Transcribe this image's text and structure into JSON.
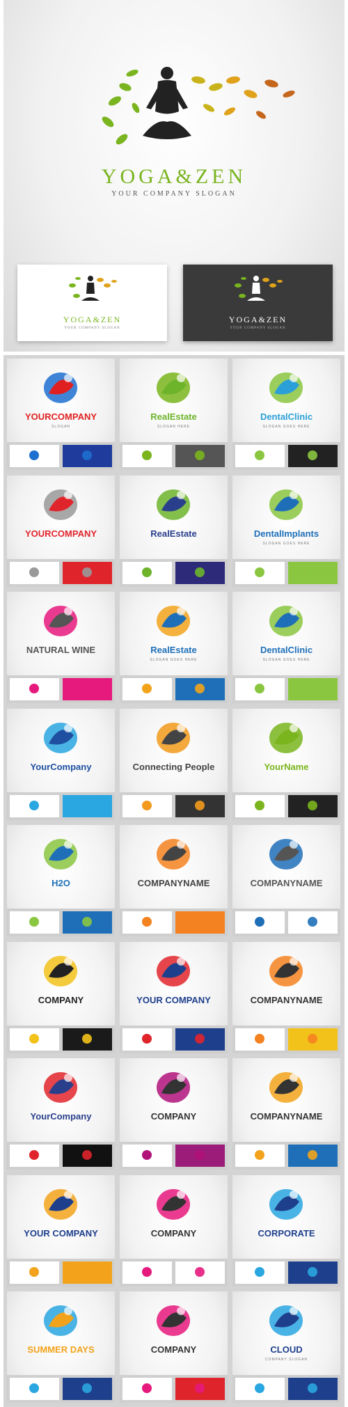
{
  "hero": {
    "title": "YOGA&ZEN",
    "slogan": "YOUR COMPANY SLOGAN",
    "title_color": "#7ab41f",
    "cards": [
      {
        "title": "YOGA&ZEN",
        "sub": "YOUR COMPANY SLOGAN",
        "variant": "light"
      },
      {
        "title": "YOGA&ZEN",
        "sub": "YOUR COMPANY SLOGAN",
        "variant": "dark"
      }
    ]
  },
  "tiles": [
    {
      "name": "YOURCOMPANY",
      "sub": "SLOGAN",
      "color": "#e02020",
      "accent": "#1d6fd0",
      "card": "#1f3c9c",
      "icon": "bird-icon"
    },
    {
      "name": "RealEstate",
      "sub": "SLOGAN HERE",
      "color": "#6db42b",
      "accent": "#7ab51d",
      "card": "#555555",
      "icon": "house-icon"
    },
    {
      "name": "DentalClinic",
      "sub": "SLOGAN GOES HERE",
      "color": "#2a9fd8",
      "accent": "#8ac640",
      "card": "#222222",
      "icon": "tooth-figure-icon"
    },
    {
      "name": "YOURCOMPANY",
      "sub": "",
      "color": "#e0242c",
      "accent": "#999999",
      "card": "#e0242c",
      "icon": "x-star-icon"
    },
    {
      "name": "RealEstate",
      "sub": "",
      "color": "#2a3f8c",
      "accent": "#6db42b",
      "card": "#2e2a7a",
      "icon": "buildings-icon"
    },
    {
      "name": "DentalImplants",
      "sub": "SLOGAN GOES HERE",
      "color": "#1e6fb8",
      "accent": "#8ac640",
      "card": "#8ac640",
      "icon": "implant-icon"
    },
    {
      "name": "NATURAL WINE",
      "sub": "",
      "color": "#555555",
      "accent": "#e6197d",
      "card": "#e6197d",
      "icon": "wine-glass-icon"
    },
    {
      "name": "RealEstate",
      "sub": "SLOGAN GOES HERE",
      "color": "#1e6fb8",
      "accent": "#f2a31b",
      "card": "#1e6fb8",
      "icon": "house-roof-icon"
    },
    {
      "name": "DentalClinic",
      "sub": "SLOGAN GOES HERE",
      "color": "#1e6fb8",
      "accent": "#8ac640",
      "card": "#8ac640",
      "icon": "tooth-icon"
    },
    {
      "name": "YourCompany",
      "sub": "",
      "color": "#1e4fa0",
      "accent": "#2aa6e0",
      "card": "#2aa6e0",
      "icon": "water-drop-icon"
    },
    {
      "name": "Connecting People",
      "sub": "",
      "color": "#444444",
      "accent": "#f29a1b",
      "card": "#333333",
      "icon": "people-icon"
    },
    {
      "name": "YourName",
      "sub": "",
      "color": "#7ab51d",
      "accent": "#7ab51d",
      "card": "#222222",
      "icon": "leaf-icon"
    },
    {
      "name": "H2O",
      "sub": "",
      "color": "#1e6fb8",
      "accent": "#8ac640",
      "card": "#1e6fb8",
      "icon": "h2o-icon"
    },
    {
      "name": "COMPANYNAME",
      "sub": "",
      "color": "#444444",
      "accent": "#f58220",
      "card": "#f58220",
      "icon": "flame-icon"
    },
    {
      "name": "COMPANYNAME",
      "sub": "",
      "color": "#555555",
      "accent": "#1e6fb8",
      "card": "#ffffff",
      "icon": "swoosh-icon"
    },
    {
      "name": "COMPANY",
      "sub": "",
      "color": "#222222",
      "accent": "#f2c21b",
      "card": "#1a1a1a",
      "icon": "triangle-icon"
    },
    {
      "name": "YOUR COMPANY",
      "sub": "",
      "color": "#1e3f8c",
      "accent": "#e0242c",
      "card": "#1e3f8c",
      "icon": "mountain-icon"
    },
    {
      "name": "COMPANYNAME",
      "sub": "",
      "color": "#333333",
      "accent": "#f58220",
      "card": "#f2c21b",
      "icon": "ring-icon"
    },
    {
      "name": "YourCompany",
      "sub": "",
      "color": "#2a3f8c",
      "accent": "#e0242c",
      "card": "#111111",
      "icon": "tree-icon"
    },
    {
      "name": "COMPANY",
      "sub": "",
      "color": "#333333",
      "accent": "#b0127a",
      "card": "#9c1c7a",
      "icon": "s-letter-icon"
    },
    {
      "name": "COMPANYNAME",
      "sub": "",
      "color": "#333333",
      "accent": "#f2a31b",
      "card": "#1e6fb8",
      "icon": "b-letter-icon"
    },
    {
      "name": "YOUR COMPANY",
      "sub": "",
      "color": "#1e3f8c",
      "accent": "#f2a31b",
      "card": "#f2a31b",
      "icon": "sun-icon"
    },
    {
      "name": "COMPANY",
      "sub": "",
      "color": "#333333",
      "accent": "#e6197d",
      "card": "#ffffff",
      "icon": "s-ribbon-icon"
    },
    {
      "name": "CORPORATE",
      "sub": "",
      "color": "#1e3f8c",
      "accent": "#2aa6e0",
      "card": "#1e3f8c",
      "icon": "globe-icon"
    },
    {
      "name": "SUMMER DAYS",
      "sub": "",
      "color": "#f2a31b",
      "accent": "#2aa6e0",
      "card": "#1e3f8c",
      "icon": "sun-wave-icon"
    },
    {
      "name": "COMPANY",
      "sub": "",
      "color": "#333333",
      "accent": "#e6197d",
      "card": "#e0242c",
      "icon": "s-swirl-icon"
    },
    {
      "name": "CLOUD",
      "sub": "COMPANY SLOGAN",
      "color": "#1e3f8c",
      "accent": "#2aa6e0",
      "card": "#1e3f8c",
      "icon": "cloud-icon"
    }
  ]
}
